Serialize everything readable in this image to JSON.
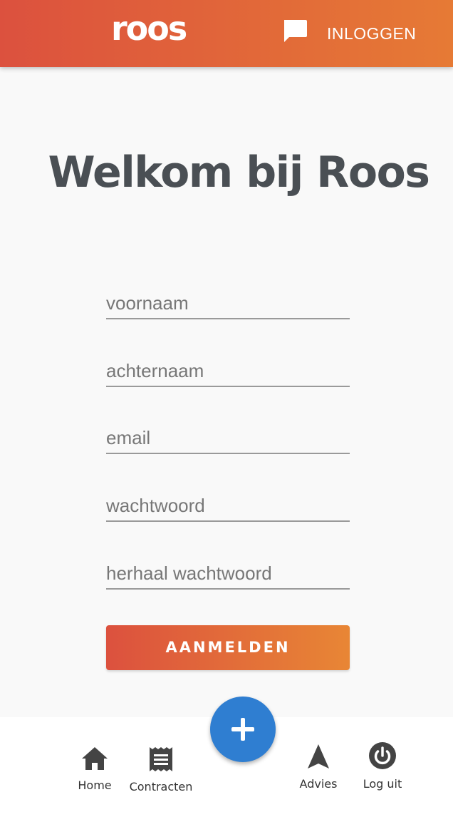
{
  "header": {
    "logo_text": "roos",
    "chat_icon": "chat-bubble-icon",
    "login_label": "INLOGGEN",
    "gradient_start": "#dc513e",
    "gradient_end": "#e67a35"
  },
  "main": {
    "title": "Welkom bij Roos"
  },
  "form": {
    "fields": [
      {
        "placeholder": "voornaam",
        "value": ""
      },
      {
        "placeholder": "achternaam",
        "value": ""
      },
      {
        "placeholder": "email",
        "value": ""
      },
      {
        "placeholder": "wachtwoord",
        "value": ""
      },
      {
        "placeholder": "herhaal wachtwoord",
        "value": ""
      }
    ],
    "submit_label": "AANMELDEN"
  },
  "bottom_nav": {
    "items": [
      {
        "label": "Home",
        "icon": "home-icon"
      },
      {
        "label": "Contracten",
        "icon": "receipt-icon"
      },
      {
        "label": "Advies",
        "icon": "navigation-arrow-icon"
      },
      {
        "label": "Log uit",
        "icon": "power-icon"
      }
    ],
    "fab_icon": "plus-icon",
    "fab_color": "#2f7ed1"
  }
}
